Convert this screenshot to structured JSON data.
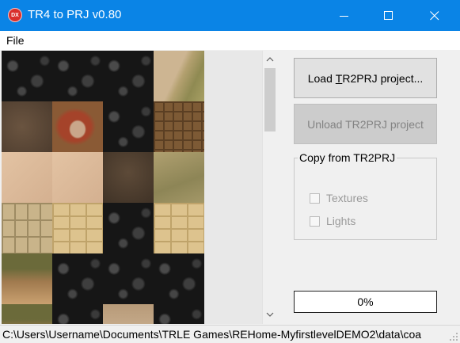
{
  "window": {
    "icon_label": "DX",
    "title": "TR4 to PRJ  v0.80"
  },
  "menu": {
    "file_label": "File"
  },
  "texture_panel": {
    "tiles": [
      "black",
      "black",
      "black",
      "sandgrass",
      "dirt",
      "rocks",
      "black",
      "bricks",
      "sand",
      "sand",
      "dirt2",
      "grass",
      "wall",
      "limestone",
      "black",
      "limestone",
      "cliff",
      "black",
      "black",
      "black",
      "cliff",
      "black",
      "carved",
      "black"
    ]
  },
  "buttons": {
    "load_prefix": "Load ",
    "load_underlined": "T",
    "load_suffix": "R2PRJ project...",
    "unload_label": "Unload TR2PRJ project"
  },
  "copy_group": {
    "title": "Copy from TR2PRJ",
    "textures_label": "Textures",
    "lights_label": "Lights",
    "textures_checked": false,
    "lights_checked": false
  },
  "progress": {
    "label": "0%",
    "value": 0
  },
  "status": {
    "path": "C:\\Users\\Username\\Documents\\TRLE Games\\REHome-MyfirstlevelDEMO2\\data\\coa"
  },
  "icons": {
    "minimize": "minimize-icon",
    "maximize": "maximize-icon",
    "close": "close-icon",
    "scroll_up": "chevron-up-icon",
    "scroll_down": "chevron-down-icon"
  },
  "colors": {
    "titlebar": "#0a84e6",
    "app_icon": "#d9302c"
  }
}
